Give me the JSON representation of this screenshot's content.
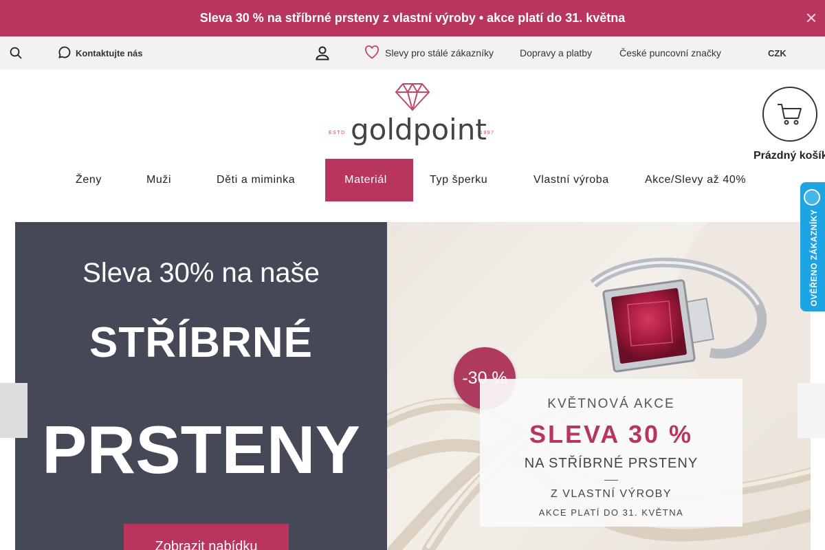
{
  "promo": {
    "icon": "",
    "text": "Sleva 30 % na stříbrné prsteny z vlastní výroby • akce platí do 31. května"
  },
  "util": {
    "contact": "Kontaktujte nás",
    "loyalty": "Slevy pro stálé zákazníky",
    "shipping": "Dopravy a platby",
    "hallmarks": "České puncovní značky",
    "language_icon": "",
    "currency": "CZK",
    "currency_caret": ""
  },
  "logo": {
    "brand": "goldpoint",
    "estd": "ESTD",
    "year": "1997"
  },
  "cart": {
    "label": "Prázdný košík"
  },
  "nav": {
    "items": [
      {
        "label": "Ženy",
        "caret": ""
      },
      {
        "label": "Muži",
        "caret": ""
      },
      {
        "label": "Děti a miminka",
        "caret": ""
      },
      {
        "label": "Materiál",
        "caret": ""
      },
      {
        "label": "Typ šperku",
        "caret": ""
      },
      {
        "label": "Vlastní výroba"
      },
      {
        "label": "Akce/Slevy až 40%"
      }
    ]
  },
  "hero": {
    "line1": "Sleva 30% na naše",
    "line2": "STŘÍBRNÉ",
    "line3": "PRSTENY",
    "cta": "Zobrazit nabídku",
    "badge": "-30 %",
    "offer": {
      "o1": "KVĚTNOVÁ AKCE",
      "o2": "SLEVA 30 %",
      "o3": "NA STŘÍBRNÉ PRSTENY",
      "o4": "Z VLASTNÍ VÝROBY",
      "o5": "AKCE PLATÍ DO 31. KVĚTNA"
    }
  },
  "slider": {
    "prev": "",
    "next": ""
  },
  "verified": {
    "text": "OVĚŘENO ZÁKAZNÍKY"
  },
  "colors": {
    "accent": "#b8355e",
    "hero_dark": "#454957",
    "widget": "#1ea3e3",
    "util_bg": "#f2f2f2"
  }
}
